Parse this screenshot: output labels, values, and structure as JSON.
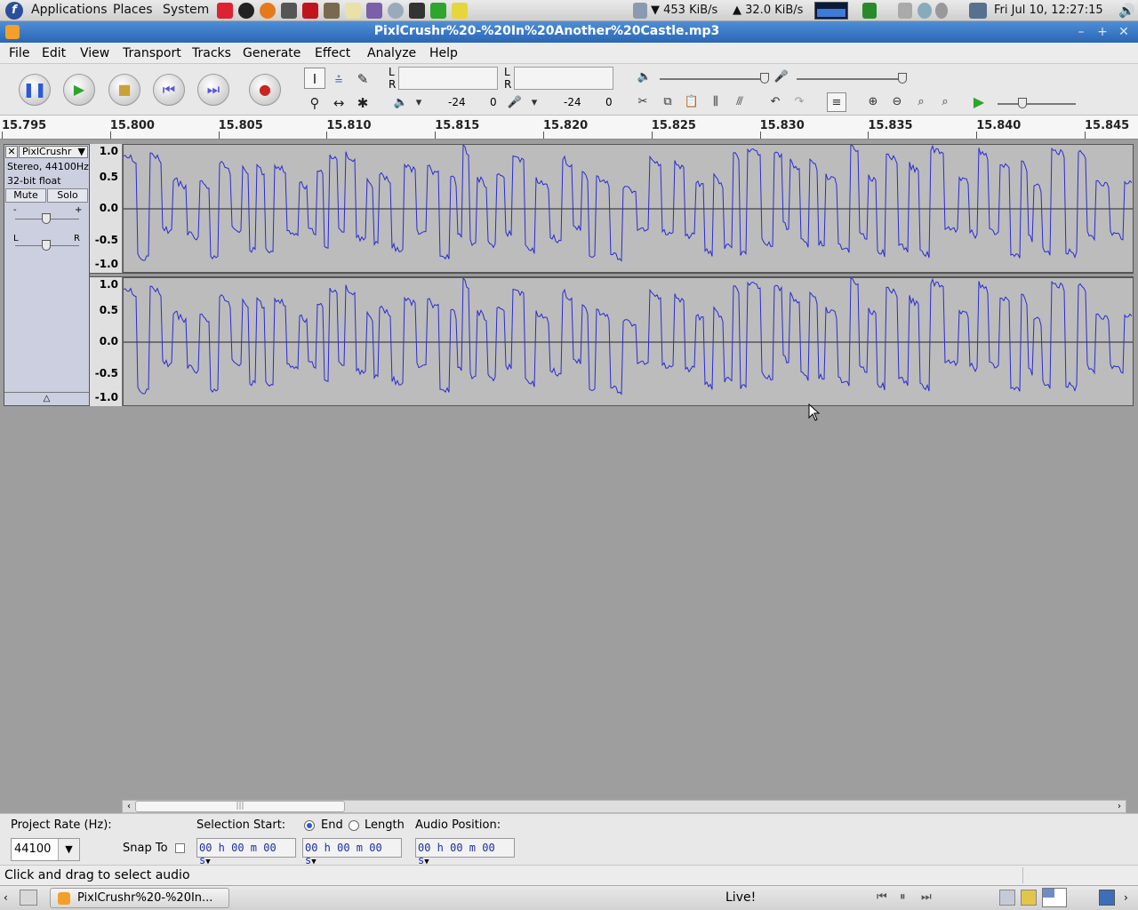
{
  "top_panel": {
    "menus": [
      "Applications",
      "Places",
      "System"
    ],
    "download_rate": "453 KiB/s",
    "upload_rate": "32.0 KiB/s",
    "clock": "Fri Jul 10, 12:27:15"
  },
  "window": {
    "title": "PixlCrushr%20-%20In%20Another%20Castle.mp3"
  },
  "menubar": [
    "File",
    "Edit",
    "View",
    "Transport",
    "Tracks",
    "Generate",
    "Effect",
    "Analyze",
    "Help"
  ],
  "meters": {
    "playback": {
      "l": "L",
      "r": "R",
      "db_low": "-24",
      "db_high": "0"
    },
    "record": {
      "l": "L",
      "r": "R",
      "db_low": "-24",
      "db_high": "0"
    }
  },
  "ruler": [
    "15.795",
    "15.800",
    "15.805",
    "15.810",
    "15.815",
    "15.820",
    "15.825",
    "15.830",
    "15.835",
    "15.840",
    "15.845"
  ],
  "track": {
    "name": "PixlCrushr",
    "format": "Stereo, 44100Hz",
    "bitdepth": "32-bit float",
    "mute_label": "Mute",
    "solo_label": "Solo",
    "gain_minus": "-",
    "gain_plus": "+",
    "pan_l": "L",
    "pan_r": "R",
    "y_labels": [
      "1.0",
      "0.5",
      "0.0",
      "-0.5",
      "-1.0"
    ]
  },
  "selection_toolbar": {
    "project_rate_label": "Project Rate (Hz):",
    "project_rate_value": "44100",
    "snap_to_label": "Snap To",
    "selection_start_label": "Selection Start:",
    "end_label": "End",
    "length_label": "Length",
    "audio_position_label": "Audio Position:",
    "timecode": "00 h 00 m 00 s"
  },
  "status": {
    "text": "Click and drag to select audio"
  },
  "taskbar": {
    "task_label": "PixlCrushr%20-%20In...",
    "live_label": "Live!"
  },
  "colors": {
    "waveform": "#2b2bd0",
    "titlebar": "#2a66b5",
    "wave_bg": "#bcbcbc"
  }
}
